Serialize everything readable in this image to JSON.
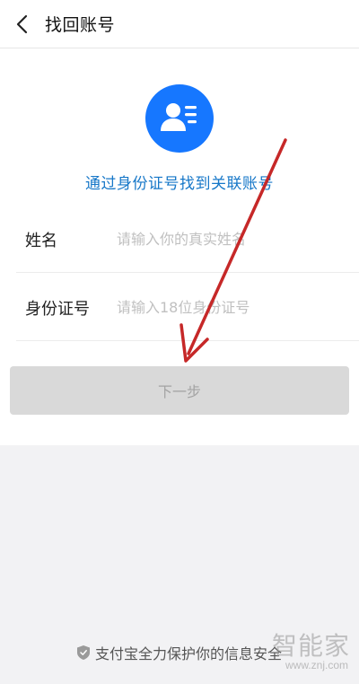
{
  "header": {
    "title": "找回账号",
    "back_icon": "chevron-left-icon"
  },
  "hero": {
    "icon": "id-card-person-icon",
    "subtitle": "通过身份证号找到关联账号"
  },
  "form": {
    "name_label": "姓名",
    "name_placeholder": "请输入你的真实姓名",
    "name_value": "",
    "id_label": "身份证号",
    "id_placeholder": "请输入18位身份证号",
    "id_value": ""
  },
  "actions": {
    "next_label": "下一步"
  },
  "footer": {
    "icon": "shield-icon",
    "text": "支付宝全力保护你的信息安全"
  },
  "watermark": {
    "title": "智能家",
    "url": "www.znj.com"
  },
  "colors": {
    "accent": "#1677ff",
    "subtitle": "#1677c8",
    "button_disabled_bg": "#d9d9d9",
    "annotation_arrow": "#c62828"
  }
}
